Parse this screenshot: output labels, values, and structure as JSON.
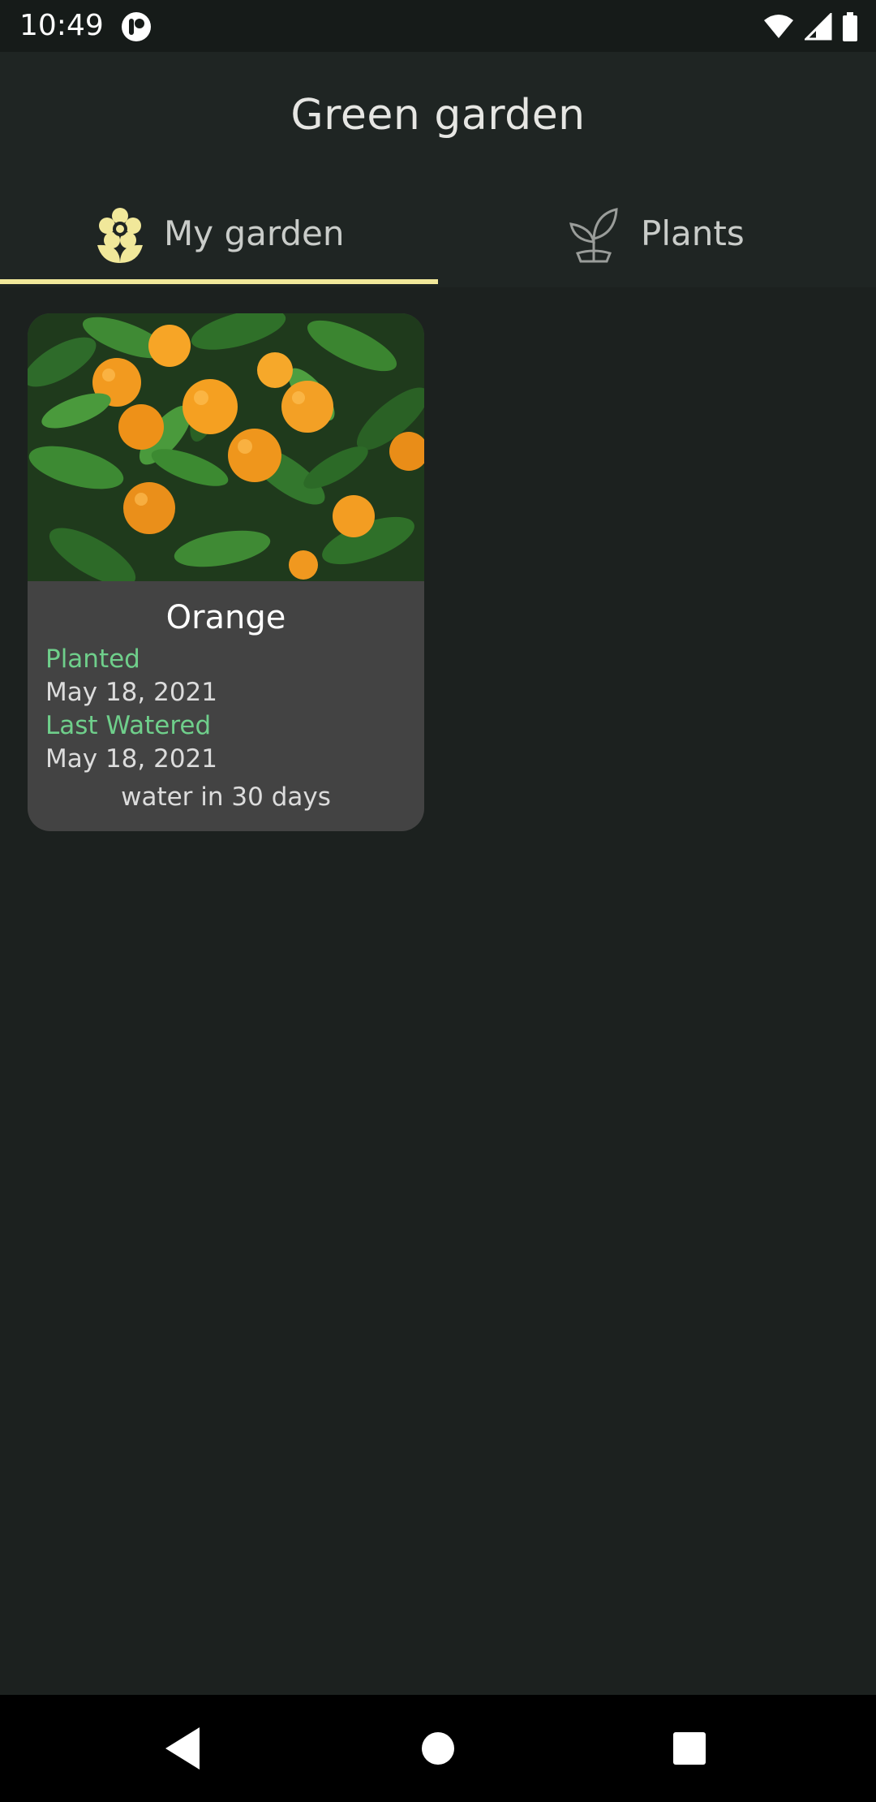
{
  "status_bar": {
    "time": "10:49",
    "icons": [
      "app-notification-icon",
      "wifi-icon",
      "signal-icon",
      "battery-icon"
    ]
  },
  "app_bar": {
    "title": "Green garden",
    "tabs": [
      {
        "label": "My garden",
        "icon": "flower-icon",
        "selected": true
      },
      {
        "label": "Plants",
        "icon": "sprout-icon",
        "selected": false
      }
    ]
  },
  "garden": {
    "plants": [
      {
        "name": "Orange",
        "planted_label": "Planted",
        "planted_date": "May 18, 2021",
        "watered_label": "Last Watered",
        "watered_date": "May 18, 2021",
        "water_due": "water in 30 days"
      }
    ]
  },
  "nav_bar": {
    "buttons": [
      "back-icon",
      "home-icon",
      "recents-icon"
    ]
  },
  "colors": {
    "background": "#1c211f",
    "app_bar": "#1f2523",
    "tab_indicator": "#f1e89a",
    "card": "#434343",
    "label_green": "#6fcf8b"
  }
}
